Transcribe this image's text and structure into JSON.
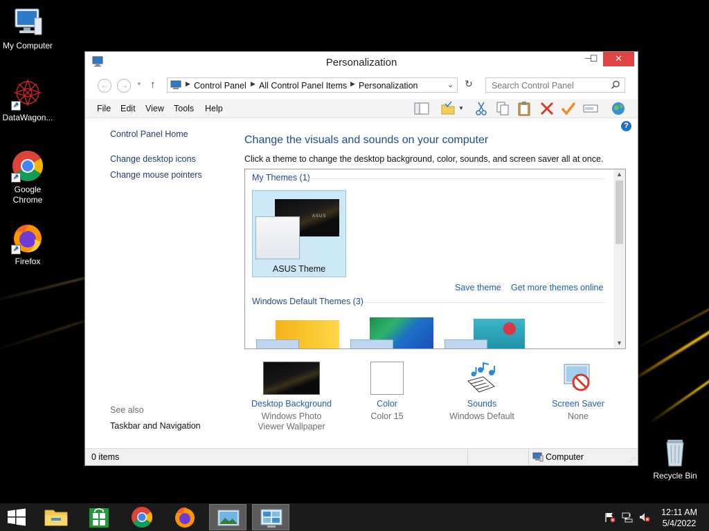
{
  "desktop": {
    "icons": [
      {
        "label": "My Computer"
      },
      {
        "label": "DataWagon..."
      },
      {
        "label": "Google Chrome"
      },
      {
        "label": "Firefox"
      },
      {
        "label": "Recycle Bin"
      }
    ]
  },
  "window": {
    "title": "Personalization",
    "controls": {
      "minimize": "—",
      "maximize": "☐",
      "close": "✕"
    },
    "breadcrumb": [
      "Control Panel",
      "All Control Panel Items",
      "Personalization"
    ],
    "search_placeholder": "Search Control Panel",
    "menu": [
      "File",
      "Edit",
      "View",
      "Tools",
      "Help"
    ],
    "help_glyph": "?"
  },
  "sidebar": {
    "home": "Control Panel Home",
    "links": [
      "Change desktop icons",
      "Change mouse pointers"
    ],
    "see_also": "See also",
    "see_also_links": [
      "Taskbar and Navigation"
    ]
  },
  "main": {
    "heading": "Change the visuals and sounds on your computer",
    "description": "Click a theme to change the desktop background, color, sounds, and screen saver all at once.",
    "my_themes_title": "My Themes (1)",
    "my_theme_name": "ASUS Theme",
    "save_theme": "Save theme",
    "get_more": "Get more themes online",
    "default_themes_title": "Windows Default Themes (3)",
    "tile_logo": "ASUS",
    "bottom": [
      {
        "title": "Desktop Background",
        "sub": "Windows Photo Viewer Wallpaper"
      },
      {
        "title": "Color",
        "sub": "Color 15"
      },
      {
        "title": "Sounds",
        "sub": "Windows Default"
      },
      {
        "title": "Screen Saver",
        "sub": "None"
      }
    ]
  },
  "statusbar": {
    "items": "0 items",
    "location": "Computer"
  },
  "taskbar": {
    "time": "12:11 AM",
    "date": "5/4/2022",
    "apps": [
      "file-explorer-icon",
      "store-icon",
      "chrome-icon",
      "firefox-icon",
      "photos-icon",
      "control-panel-icon"
    ]
  },
  "colors": {
    "accent_link": "#1f5fa8",
    "heading": "#1e4a8a",
    "close_button": "#e04343",
    "selection": "#cce8f7"
  }
}
